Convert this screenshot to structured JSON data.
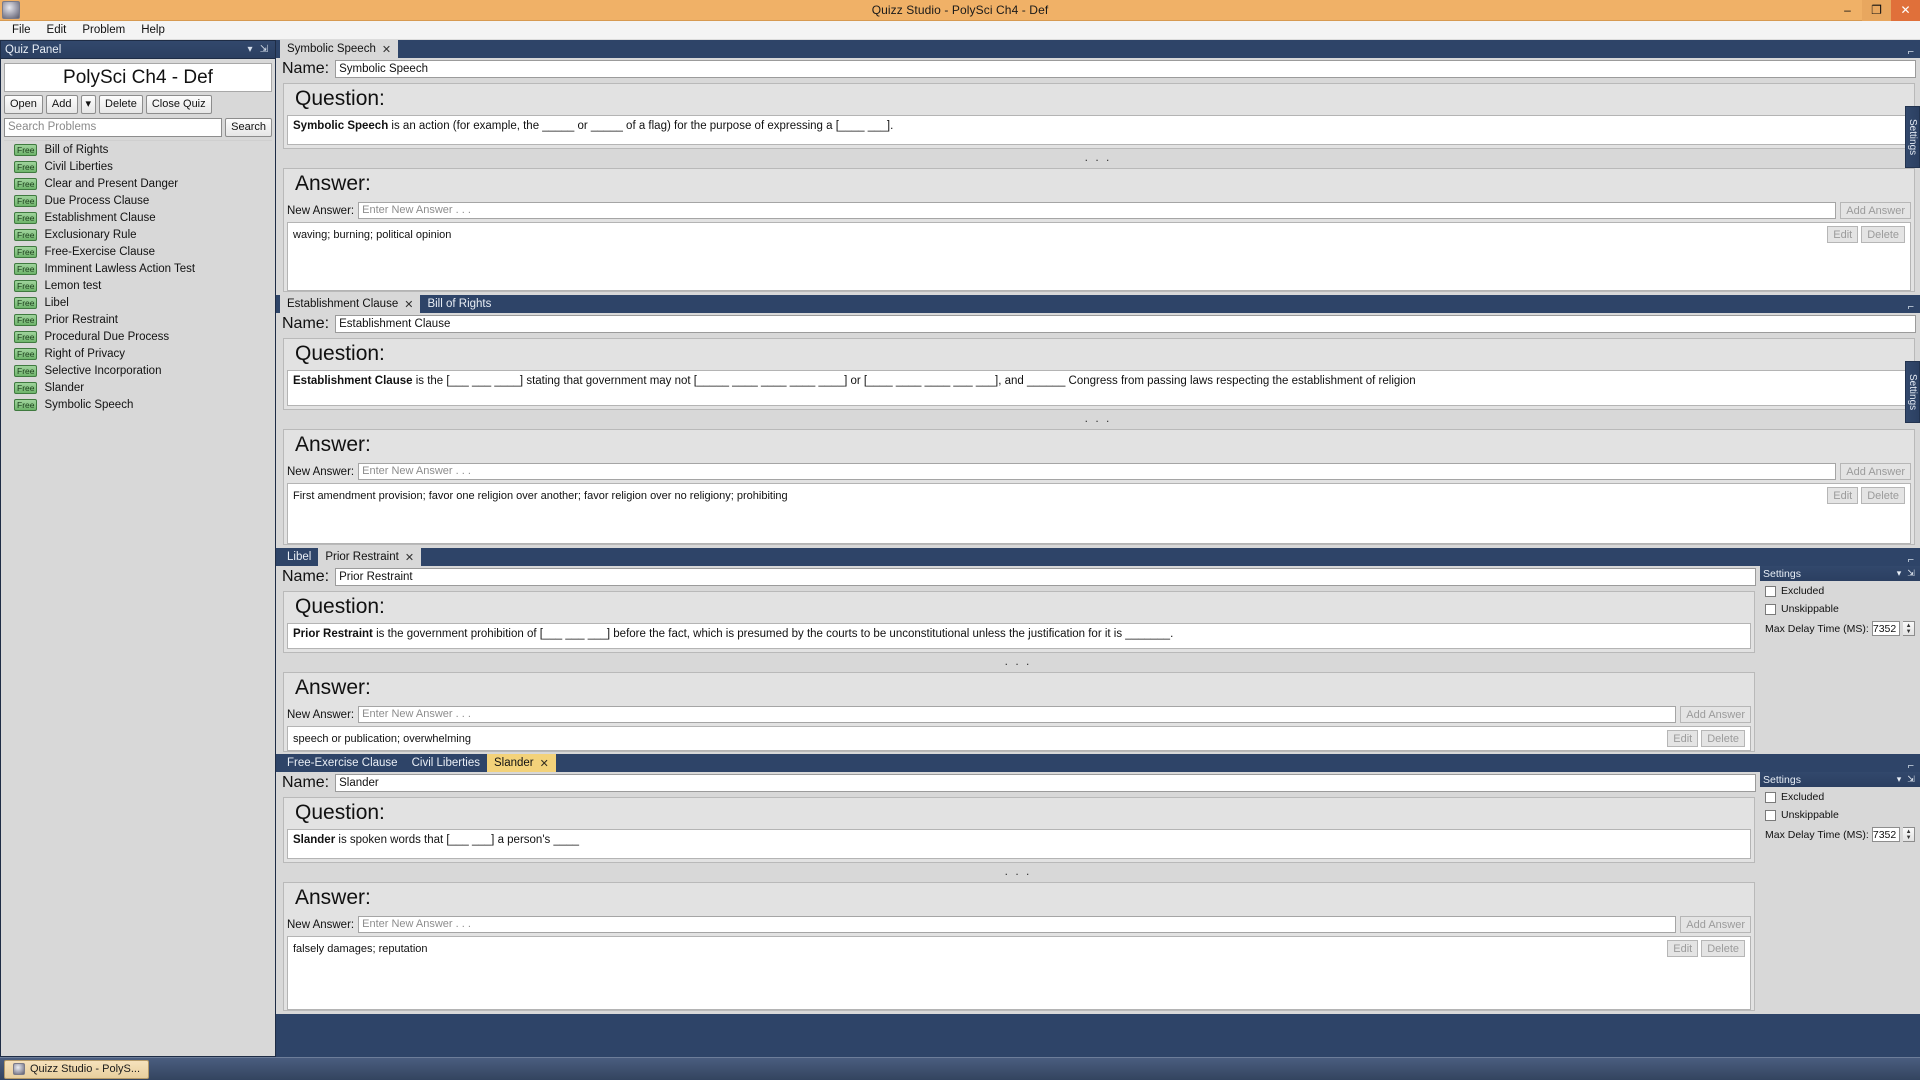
{
  "window": {
    "title": "Quizz Studio  - PolySci Ch4 - Def",
    "app_icon": "app-icon",
    "minimize": "–",
    "restore": "❐",
    "close": "✕"
  },
  "menubar": {
    "items": [
      "File",
      "Edit",
      "Problem",
      "Help"
    ]
  },
  "quiz_panel": {
    "header": "Quiz Panel",
    "collapse_icon": "▾",
    "pin_icon": "⇲",
    "quiz_title": "PolySci Ch4 - Def",
    "buttons": [
      "Open",
      "Add",
      "▾",
      "Delete",
      "Close Quiz"
    ],
    "search": {
      "placeholder": "Search Problems",
      "button": "Search"
    },
    "badge": "Free",
    "problems": [
      "Bill of Rights",
      "Civil Liberties",
      "Clear and Present Danger",
      "Due Process Clause",
      "Establishment Clause",
      "Exclusionary Rule",
      "Free-Exercise Clause",
      "Imminent Lawless Action Test",
      "Lemon test",
      "Libel",
      "Prior Restraint",
      "Procedural Due Process",
      "Right of Privacy",
      "Selective Incorporation",
      "Slander",
      "Symbolic Speech"
    ]
  },
  "labels": {
    "name": "Name:",
    "question": "Question:",
    "answer": "Answer:",
    "new_answer": "New Answer:",
    "add_answer": "Add Answer",
    "edit": "Edit",
    "delete": "Delete",
    "new_answer_placeholder": "Enter New Answer . . .",
    "dots": ". . .",
    "minimize": "⌐",
    "settings_vtab": "Settings"
  },
  "settings": {
    "header": "Settings",
    "collapse_icon": "▾",
    "pin_icon": "⇲",
    "excluded": "Excluded",
    "unskippable": "Unskippable",
    "max_delay": "Max Delay Time (MS):",
    "max_delay_value": "7352",
    "spin_up": "▲",
    "spin_down": "▼"
  },
  "panels": [
    {
      "tabs": [
        {
          "label": "Symbolic Speech",
          "active": true,
          "closable": true,
          "style": "light"
        }
      ],
      "name_value": "Symbolic Speech",
      "question_bold": "Symbolic Speech",
      "question_rest": " is an action (for example, the _____ or _____ of a flag) for the purpose of expressing a [____ ___].",
      "answers": [
        "waving; burning; political opinion"
      ],
      "settings_visible": false
    },
    {
      "tabs": [
        {
          "label": "Establishment Clause",
          "active": true,
          "closable": true,
          "style": "light"
        },
        {
          "label": "Bill of Rights",
          "active": false,
          "closable": false,
          "style": "light"
        }
      ],
      "name_value": "Establishment Clause",
      "question_bold": "Establishment Clause",
      "question_rest": " is the [___ ___ ____] stating that government may not [_____ ____ ____ ____ ____] or [____ ____ ____ ___ ___], and ______ Congress from passing laws respecting the establishment of religion",
      "answers": [
        "First amendment provision; favor one religion over another; favor religion over no religiony; prohibiting"
      ],
      "settings_visible": false
    },
    {
      "tabs": [
        {
          "label": "Libel",
          "active": false,
          "closable": false,
          "style": "light"
        },
        {
          "label": "Prior Restraint",
          "active": true,
          "closable": true,
          "style": "light"
        }
      ],
      "name_value": "Prior Restraint",
      "question_bold": "Prior Restraint",
      "question_rest": " is the government prohibition of [___ ___ ___] before the fact, which is presumed by the courts to be unconstitutional unless the justification for it is _______.",
      "answers": [
        "speech or publication; overwhelming"
      ],
      "settings_visible": true
    },
    {
      "tabs": [
        {
          "label": "Free-Exercise Clause",
          "active": false,
          "closable": false,
          "style": "light"
        },
        {
          "label": "Civil Liberties",
          "active": false,
          "closable": false,
          "style": "light"
        },
        {
          "label": "Slander",
          "active": true,
          "closable": true,
          "style": "yellow"
        }
      ],
      "name_value": "Slander",
      "question_bold": "Slander",
      "question_rest": " is spoken words that [___ ___] a person's ____",
      "answers": [
        "falsely damages; reputation"
      ],
      "settings_visible": true
    }
  ],
  "taskbar": {
    "task_label": "Quizz Studio  - PolyS..."
  },
  "colors": {
    "title_bar": "#f0b167",
    "dock_blue": "#2e4468",
    "panel_gray": "#d8d8d8",
    "badge_green": "#6fb46c",
    "active_tab_yellow": "#f3d27a"
  }
}
